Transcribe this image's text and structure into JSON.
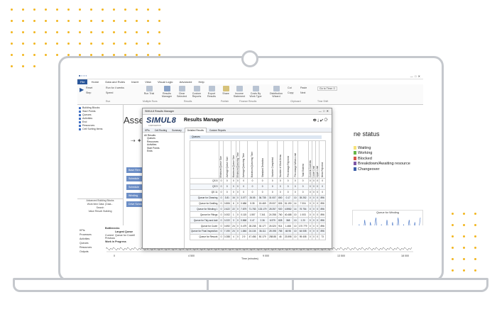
{
  "app": {
    "title": "SIMUL8",
    "ribbon_tabs": [
      "File",
      "Home",
      "Data and Rules",
      "Insert",
      "View",
      "Visual Logic",
      "Advanced",
      "Help"
    ],
    "ribbon_items": [
      "Reset",
      "Step",
      "Run for 4 weeks",
      "Speed",
      "Run Trial",
      "Results Manager",
      "Clear Selected",
      "Custom Reports",
      "Export Results",
      "Share",
      "Income Statement",
      "Costs By Work Type",
      "Distribution Wizard",
      "Cut",
      "Copy",
      "Paste",
      "Next",
      "Go to Time: 0"
    ],
    "ribbon_groups": [
      "Run",
      "Multiple Runs",
      "Results",
      "Publish",
      "Finance Results",
      "Clipboard",
      "Time Shift"
    ],
    "tree_items": [
      "Building Blocks",
      "Start Points",
      "Queues",
      "Activities",
      "End",
      "Resources",
      "Cell Sorting Items"
    ],
    "left_footer": [
      "Advanced Building Blocks",
      "Work Item Data: (Data...",
      "Search",
      "Value Result: Building"
    ],
    "canvas_title": "Assem",
    "canvas_buttons": [
      "Base Rem",
      "Schedule",
      "Schedule",
      "Winding",
      "Drive Sched"
    ],
    "status_title": "ne status",
    "status_legend": [
      {
        "label": "Waiting",
        "color": "#f6e27a"
      },
      {
        "label": "Working",
        "color": "#67b548"
      },
      {
        "label": "Blocked",
        "color": "#d7564a"
      },
      {
        "label": "Breakdown/Awaiting resource",
        "color": "#7e57a5"
      },
      {
        "label": "Changeover",
        "color": "#3b5ea8"
      }
    ],
    "mini_chart": {
      "title": "Queue for Winding",
      "series": [
        5,
        12,
        3,
        14,
        2,
        13,
        6,
        15,
        4,
        12,
        3,
        14,
        5,
        13,
        2,
        15,
        4,
        12,
        6,
        14,
        3,
        13,
        5,
        15
      ]
    },
    "bottom_tabs": [
      "KPIs",
      "Processes",
      "Activities",
      "Queues",
      "Resources",
      "Outputs"
    ],
    "bottom_pane": {
      "header": "Bottlenecks",
      "subheader": "Largest Queue",
      "current_label": "Current",
      "current_value": "Queue for Cover",
      "current_num": "0",
      "previous_label": "Previous",
      "wip_label": "Work in Progress",
      "x_axis": "Time (minutes)",
      "ticks": [
        "0",
        "4 500",
        "9 000",
        "13 500",
        "18 000"
      ]
    }
  },
  "dialog": {
    "title": "SIMUL8 Results Manager",
    "logo": "SIMUL8",
    "logo_sub": "CORPORATION",
    "heading": "Results Manager",
    "tabs": [
      "KPIs",
      "Cell Routing",
      "Summary",
      "Detailed Results",
      "Custom Reports"
    ],
    "side_items": [
      "All Results",
      "Queues",
      "Resources",
      "Activities",
      "Start Points",
      "Ends"
    ],
    "section": "Queues",
    "table": {
      "columns": [
        "Minimum Queue Size",
        "Average Queue Size",
        "Maximum Queue Size",
        "Minimum Queueing Time",
        "Average Queueing Time",
        "Maximum Queueing Time",
        "Standard Deviation",
        "Number Completed",
        "Number of Work Items",
        "Percentage Rejected",
        "Percentage Within Limit",
        "Total Entered",
        "Current Contents",
        "Lower Limit",
        "Upper Limit",
        "Items Rejected"
      ],
      "rows": [
        {
          "name": "QS 8",
          "cells": [
            "0",
            "0",
            "0",
            "0",
            "0",
            "0",
            "0",
            "0",
            "0",
            "0",
            "0",
            "0",
            "0",
            "0",
            "0",
            "0"
          ]
        },
        {
          "name": "QS 9",
          "cells": [
            "0",
            "0",
            "0",
            "0",
            "0",
            "0",
            "0",
            "0",
            "0",
            "0",
            "0",
            "0",
            "0",
            "0",
            "0",
            "0"
          ]
        },
        {
          "name": "QS 11",
          "cells": [
            "0",
            "0",
            "0",
            "0",
            "0",
            "0",
            "0",
            "0",
            "0",
            "0",
            "0",
            "0",
            "0",
            "0",
            "0",
            "0"
          ]
        },
        {
          "name": "Queue for Cleaning",
          "cells": [
            "0",
            "3.81",
            "16",
            "0",
            "3.077",
            "26.55",
            "36.735",
            "31 007",
            "800",
            "0.17",
            "10",
            "35 252",
            "0",
            "0",
            "0",
            "896"
          ]
        },
        {
          "name": "Queue for Drafting",
          "cells": [
            "0",
            "0.806",
            "6",
            "0",
            "0.686",
            "5.35",
            "15.469",
            "25 007",
            "826",
            "51.190",
            "14",
            "7 004",
            "0",
            "0",
            "0",
            "896"
          ]
        },
        {
          "name": "Queue for Winding 1",
          "cells": [
            "0",
            "2.622",
            "22",
            "0",
            "7.879",
            "71.783",
            "133.179",
            "28 257",
            "920",
            "4.5982",
            "14",
            "76 754",
            "0",
            "0",
            "0",
            "896"
          ]
        },
        {
          "name": "Queue for Fitings",
          "cells": [
            "0",
            "0.002",
            "1",
            "0",
            "0.115",
            "1.557",
            "7.341",
            "24 258",
            "760",
            "40.488",
            "10",
            "1 003",
            "0",
            "0",
            "0",
            "896"
          ]
        },
        {
          "name": "Queue for Tidy and Add",
          "cells": [
            "0",
            "0.222",
            "3",
            "0",
            "0.868",
            "0.47",
            "2.36",
            "6.979",
            "828",
            "368",
            "10",
            "1 20",
            "0",
            "0",
            "0",
            "896"
          ]
        },
        {
          "name": "Queue for Cover",
          "cells": [
            "0",
            "0.692",
            "24",
            "0",
            "0.479",
            "28.208",
            "30.177",
            "26 320",
            "914",
            "1.468",
            "10",
            "170 779",
            "0",
            "0",
            "0",
            "896"
          ]
        },
        {
          "name": "Queue for Final Inspection",
          "cells": [
            "0",
            "7.190",
            "24",
            "0",
            "1.846",
            "24.104",
            "36.111",
            "28 198",
            "765",
            "48.98",
            "10",
            "64 008",
            "0",
            "0",
            "0",
            "896"
          ]
        },
        {
          "name": "Queue for Rework",
          "cells": [
            "0",
            "0.288",
            "4",
            "0",
            "2.9",
            "47.456",
            "50.179",
            "258.88",
            "46",
            "23.598",
            "10",
            "95 408",
            "0",
            "0",
            "0",
            "73"
          ]
        }
      ]
    }
  }
}
